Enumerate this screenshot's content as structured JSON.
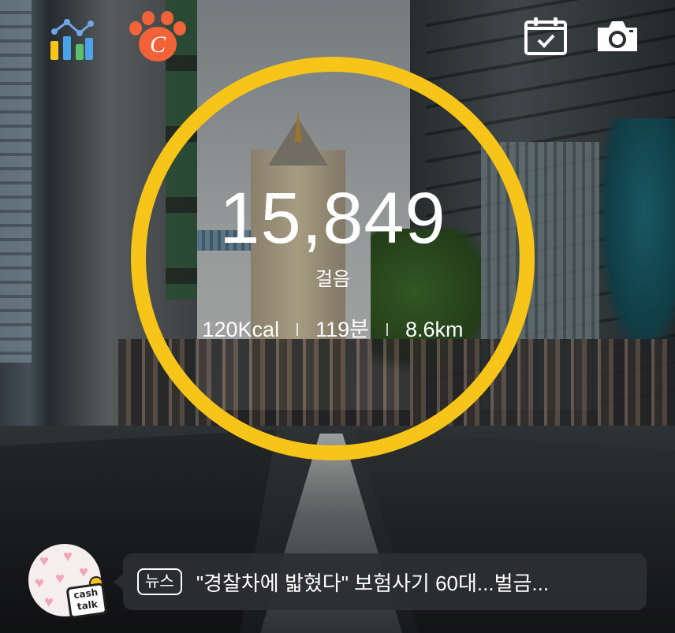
{
  "header": {
    "left_icons": [
      "stats-chart-icon",
      "cashwalk-paw-icon"
    ],
    "right_icons": [
      "calendar-check-icon",
      "camera-icon"
    ],
    "paw_letter": "C"
  },
  "activity": {
    "steps": "15,849",
    "steps_label": "걸음",
    "calories": "120Kcal",
    "duration": "119분",
    "distance": "8.6km",
    "ring_color": "#f7c519"
  },
  "news": {
    "badge_line1": "cash",
    "badge_line2": "talk",
    "tag": "뉴스",
    "headline": "\"경찰차에 밟혔다\" 보험사기 60대...벌금..."
  }
}
